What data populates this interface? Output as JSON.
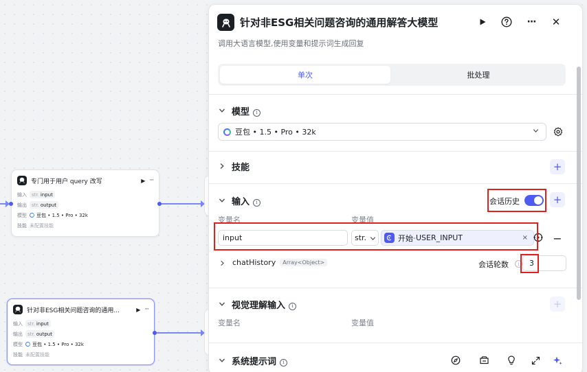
{
  "canvas": {
    "nodes": [
      {
        "title": "专门用于用户 query 改写",
        "input_label": "输入",
        "input_type": "str.",
        "input_name": "input",
        "output_label": "输出",
        "output_type": "str.",
        "output_name": "output",
        "model_label": "模型",
        "model_value": "豆包 • 1.5 • Pro • 32k",
        "skills_label": "技能",
        "skills_value": "未配置技能"
      },
      {
        "title": "针对非ESG相关问题咨询的通用...",
        "input_label": "输入",
        "input_type": "str.",
        "input_name": "input",
        "output_label": "输出",
        "output_type": "str.",
        "output_name": "output",
        "model_label": "模型",
        "model_value": "豆包 • 1.5 • Pro • 32k",
        "skills_label": "技能",
        "skills_value": "未配置技能"
      }
    ]
  },
  "panel": {
    "title": "针对非ESG相关问题咨询的通用解答大模型",
    "description": "调用大语言模型,使用变量和提示词生成回复",
    "icons": {
      "run": "play-icon",
      "help": "help-icon",
      "more": "more-icon",
      "close": "close-icon"
    },
    "more_glyph": "···",
    "close_glyph": "✕",
    "tabs": [
      {
        "label": "单次",
        "active": true
      },
      {
        "label": "批处理",
        "active": false
      }
    ],
    "model_section": {
      "title": "模型",
      "selected_model": "豆包 • 1.5 • Pro • 32k"
    },
    "skills_section": {
      "title": "技能"
    },
    "input_section": {
      "title": "输入",
      "history_label": "会话历史",
      "history_enabled": true,
      "col_name": "变量名",
      "col_value": "变量值",
      "row": {
        "name": "input",
        "type": "str.",
        "ref_source": "开始",
        "ref_separator": " - ",
        "ref_variable": "USER_INPUT"
      },
      "history_var": {
        "name": "chatHistory",
        "type": "Array<Object>",
        "rounds_label": "会话轮数",
        "rounds_value": "3"
      }
    },
    "vision_section": {
      "title": "视觉理解输入",
      "col_name": "变量名",
      "col_value": "变量值"
    },
    "system_prompt_section": {
      "title": "系统提示词"
    },
    "colors": {
      "accent": "#4e5bf0",
      "highlight": "#e0201c"
    }
  }
}
